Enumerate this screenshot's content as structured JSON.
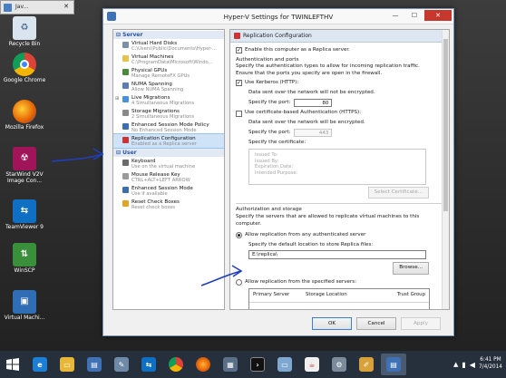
{
  "desktop": {
    "top_window_label": "Jav...",
    "icons": [
      {
        "label": "Recycle Bin",
        "icon": "recycle-bin-icon"
      },
      {
        "label": "Google Chrome",
        "icon": "chrome-icon"
      },
      {
        "label": "Mozilla Firefox",
        "icon": "firefox-icon"
      },
      {
        "label": "StarWind V2V Image Con...",
        "icon": "starwind-icon"
      },
      {
        "label": "TeamViewer 9",
        "icon": "teamviewer-icon"
      },
      {
        "label": "WinSCP",
        "icon": "winscp-icon"
      },
      {
        "label": "Virtual Machi...",
        "icon": "virtual-machine-icon"
      }
    ]
  },
  "window": {
    "title": "Hyper-V Settings for TWINLEFTHV",
    "buttons": {
      "minimize": "—",
      "maximize": "☐",
      "close": "✕"
    }
  },
  "sidebar": {
    "server_header": "Server",
    "user_header": "User",
    "server_items": [
      {
        "label": "Virtual Hard Disks",
        "sub": "C:\\Users\\Public\\Documents\\Hyper-...",
        "expand": ""
      },
      {
        "label": "Virtual Machines",
        "sub": "C:\\ProgramData\\Microsoft\\Windo...",
        "expand": ""
      },
      {
        "label": "Physical GPUs",
        "sub": "Manage RemoteFX GPUs",
        "expand": ""
      },
      {
        "label": "NUMA Spanning",
        "sub": "Allow NUMA Spanning",
        "expand": ""
      },
      {
        "label": "Live Migrations",
        "sub": "4 Simultaneous Migrations",
        "expand": "⊞"
      },
      {
        "label": "Storage Migrations",
        "sub": "2 Simultaneous Migrations",
        "expand": ""
      },
      {
        "label": "Enhanced Session Mode Policy",
        "sub": "No Enhanced Session Mode",
        "expand": ""
      },
      {
        "label": "Replication Configuration",
        "sub": "Enabled as a Replica server",
        "expand": ""
      }
    ],
    "user_items": [
      {
        "label": "Keyboard",
        "sub": "Use on the virtual machine"
      },
      {
        "label": "Mouse Release Key",
        "sub": "CTRL+ALT+LEFT ARROW"
      },
      {
        "label": "Enhanced Session Mode",
        "sub": "Use if available"
      },
      {
        "label": "Reset Check Boxes",
        "sub": "Reset check boxes"
      }
    ]
  },
  "panel": {
    "header": "Replication Configuration",
    "enable_label": "Enable this computer as a Replica server.",
    "auth_ports_title": "Authentication and ports",
    "auth_ports_desc": "Specify the authentication types to allow for incoming replication traffic. Ensure that the ports you specify are open in the firewall.",
    "kerberos_label": "Use Kerberos (HTTP):",
    "kerberos_note": "Data sent over the network will not be encrypted.",
    "port_label": "Specify the port:",
    "kerberos_port": "80",
    "cert_label": "Use certificate-based Authentication (HTTPS):",
    "cert_note": "Data sent over the network will be encrypted.",
    "cert_port": "443",
    "certificate_label": "Specify the certificate:",
    "cert_fields": [
      "Issued To:",
      "Issued By:",
      "Expiration Date:",
      "Intended Purpose:"
    ],
    "select_cert_button": "Select Certificate...",
    "auth_storage_title": "Authorization and storage",
    "auth_storage_desc": "Specify the servers that are allowed to replicate virtual machines to this computer.",
    "allow_any_label": "Allow replication from any authenticated server",
    "default_location_label": "Specify the default location to store Replica files:",
    "location_value": "E:\\replica\\",
    "browse_button": "Browse...",
    "allow_specified_label": "Allow replication from the specified servers:",
    "grid_headers": [
      "Primary Server",
      "Storage Location",
      "Trust Group"
    ]
  },
  "footer": {
    "ok": "OK",
    "cancel": "Cancel",
    "apply": "Apply"
  },
  "taskbar": {
    "apps": [
      "windows-start-icon",
      "internet-explorer-icon",
      "file-explorer-icon",
      "hyper-v-manager-icon",
      "tools-icon",
      "teamviewer-taskbar-icon",
      "chrome-taskbar-icon",
      "firefox-taskbar-icon",
      "server-manager-icon",
      "command-prompt-icon",
      "computer-icon",
      "java-icon",
      "settings-icon",
      "paint-icon",
      "hyper-v-settings-icon"
    ],
    "time": "6:41 PM",
    "date": "7/4/2014"
  },
  "colors": {
    "accent": "#2d55a0",
    "selection": "#cfe3f8",
    "close": "#c6382d",
    "arrow": "#1f3fbf"
  }
}
